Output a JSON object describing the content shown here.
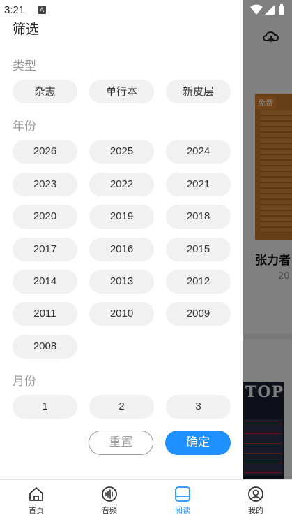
{
  "status_bar": {
    "time": "3:21",
    "notif_glyph": "A"
  },
  "background": {
    "free_badge": "免费",
    "book_title_partial": "张力者",
    "book_year_partial": "20",
    "cover_text": "TOP"
  },
  "drawer": {
    "title": "筛选",
    "type_label": "类型",
    "types": [
      "杂志",
      "单行本",
      "新皮层"
    ],
    "year_label": "年份",
    "years": [
      "2026",
      "2025",
      "2024",
      "2023",
      "2022",
      "2021",
      "2020",
      "2019",
      "2018",
      "2017",
      "2016",
      "2015",
      "2014",
      "2013",
      "2012",
      "2011",
      "2010",
      "2009",
      "2008"
    ],
    "month_label": "月份",
    "months": [
      "1",
      "2",
      "3"
    ],
    "reset_label": "重置",
    "confirm_label": "确定"
  },
  "bottom_nav": {
    "items": [
      {
        "label": "首页",
        "icon": "home-icon"
      },
      {
        "label": "音频",
        "icon": "audio-icon"
      },
      {
        "label": "阅读",
        "icon": "book-icon"
      },
      {
        "label": "我的",
        "icon": "profile-icon"
      }
    ],
    "active_index": 2
  },
  "colors": {
    "accent": "#1e90ff",
    "chip_bg": "#f1f1f1",
    "label_gray": "#9a9a9a"
  }
}
